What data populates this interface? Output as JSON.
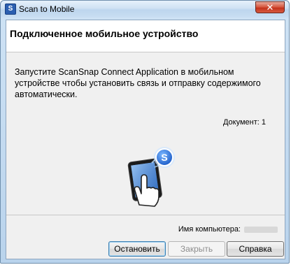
{
  "window": {
    "title": "Scan to Mobile",
    "icon": "scansnap-s-icon",
    "close_symbol": "✕"
  },
  "header": {
    "title": "Подключенное мобильное устройство"
  },
  "content": {
    "instructions": "Запустите ScanSnap Connect Application в мобильном устройстве чтобы установить связь и отправку содержимого автоматически.",
    "document_count_label": "Документ: 1",
    "illustration": "tablet-touch-icon"
  },
  "footer": {
    "computer_name_label": "Имя компьютера:",
    "buttons": {
      "stop": "Остановить",
      "close": "Закрыть",
      "help": "Справка"
    }
  },
  "colors": {
    "accent": "#2b5fb0",
    "badge_blue": "#1e6fd9",
    "close_button": "#c4321c"
  }
}
